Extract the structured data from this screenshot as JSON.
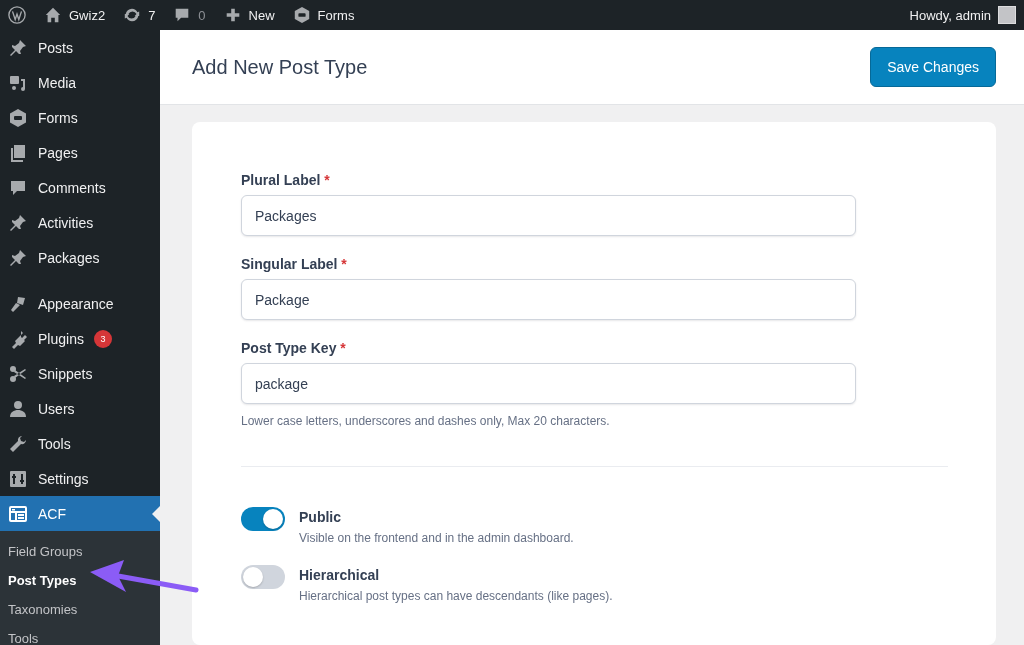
{
  "admin_bar": {
    "site_name": "Gwiz2",
    "updates": "7",
    "comments": "0",
    "new": "New",
    "forms": "Forms",
    "greeting": "Howdy, admin"
  },
  "sidebar": {
    "items": [
      {
        "label": "Posts",
        "selected": false
      },
      {
        "label": "Media",
        "selected": false
      },
      {
        "label": "Forms",
        "selected": false
      },
      {
        "label": "Pages",
        "selected": false
      },
      {
        "label": "Comments",
        "selected": false
      },
      {
        "label": "Activities",
        "selected": false
      },
      {
        "label": "Packages",
        "selected": false
      },
      {
        "label": "Appearance",
        "selected": false
      },
      {
        "label": "Plugins",
        "selected": false,
        "badge": "3"
      },
      {
        "label": "Snippets",
        "selected": false
      },
      {
        "label": "Users",
        "selected": false
      },
      {
        "label": "Tools",
        "selected": false
      },
      {
        "label": "Settings",
        "selected": false
      },
      {
        "label": "ACF",
        "selected": true
      }
    ],
    "submenu": [
      {
        "label": "Field Groups",
        "selected": false
      },
      {
        "label": "Post Types",
        "selected": true
      },
      {
        "label": "Taxonomies",
        "selected": false
      },
      {
        "label": "Tools",
        "selected": false
      }
    ]
  },
  "page": {
    "title": "Add New Post Type",
    "save_button": "Save Changes"
  },
  "fields": [
    {
      "label": "Plural Label",
      "required": "*",
      "value": "Packages"
    },
    {
      "label": "Singular Label",
      "required": "*",
      "value": "Package"
    },
    {
      "label": "Post Type Key",
      "required": "*",
      "value": "package",
      "hint": "Lower case letters, underscores and dashes only, Max 20 characters."
    }
  ],
  "toggles": [
    {
      "label": "Public",
      "description": "Visible on the frontend and in the admin dashboard.",
      "on": true
    },
    {
      "label": "Hierarchical",
      "description": "Hierarchical post types can have descendants (like pages).",
      "on": false
    }
  ]
}
